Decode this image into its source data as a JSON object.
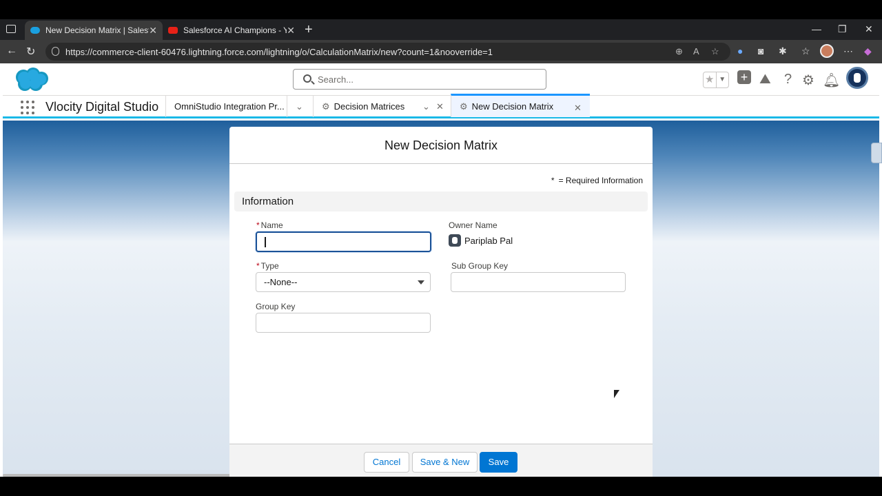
{
  "browser": {
    "tabs": [
      {
        "title": "New Decision Matrix | Salesforce",
        "active": true
      },
      {
        "title": "Salesforce AI Champions - YouTube",
        "active": false
      }
    ],
    "url": "https://commerce-client-60476.lightning.force.com/lightning/o/CalculationMatrix/new?count=1&nooverride=1"
  },
  "header": {
    "search_placeholder": "Search..."
  },
  "nav": {
    "app_name": "Vlocity Digital Studio",
    "tabs": [
      {
        "label": "OmniStudio Integration Pr..."
      },
      {
        "label": "Decision Matrices"
      },
      {
        "label": "New Decision Matrix",
        "active": true
      }
    ]
  },
  "modal": {
    "title": "New Decision Matrix",
    "required_info": "= Required Information",
    "required_marker": "*",
    "section_title": "Information",
    "fields": {
      "name_label": "Name",
      "name_value": "",
      "type_label": "Type",
      "type_value": "--None--",
      "group_key_label": "Group Key",
      "group_key_value": "",
      "owner_label": "Owner Name",
      "owner_value": "Pariplab Pal",
      "sub_group_key_label": "Sub Group Key",
      "sub_group_key_value": ""
    },
    "buttons": {
      "cancel": "Cancel",
      "save_new": "Save & New",
      "save": "Save"
    }
  },
  "colors": {
    "brand": "#0176d3",
    "tab_accent": "#1ab9e7",
    "required": "#ba0517"
  }
}
